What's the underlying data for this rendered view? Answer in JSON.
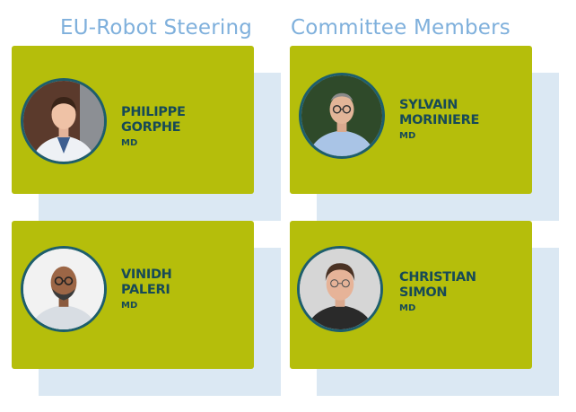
{
  "heading": {
    "left": "EU-Robot Steering",
    "right": "Committee Members"
  },
  "members": [
    {
      "first": "PHILIPPE",
      "last": "GORPHE",
      "title": "MD"
    },
    {
      "first": "SYLVAIN",
      "last": "MORINIERE",
      "title": "MD"
    },
    {
      "first": "VINIDH",
      "last": "PALERI",
      "title": "MD"
    },
    {
      "first": "CHRISTIAN",
      "last": "SIMON",
      "title": "MD"
    }
  ],
  "colors": {
    "card": "#b5be0b",
    "shadow": "#dbe8f3",
    "heading": "#7fb0dc",
    "name": "#174a57",
    "photo_border": "#1d5e6c"
  }
}
